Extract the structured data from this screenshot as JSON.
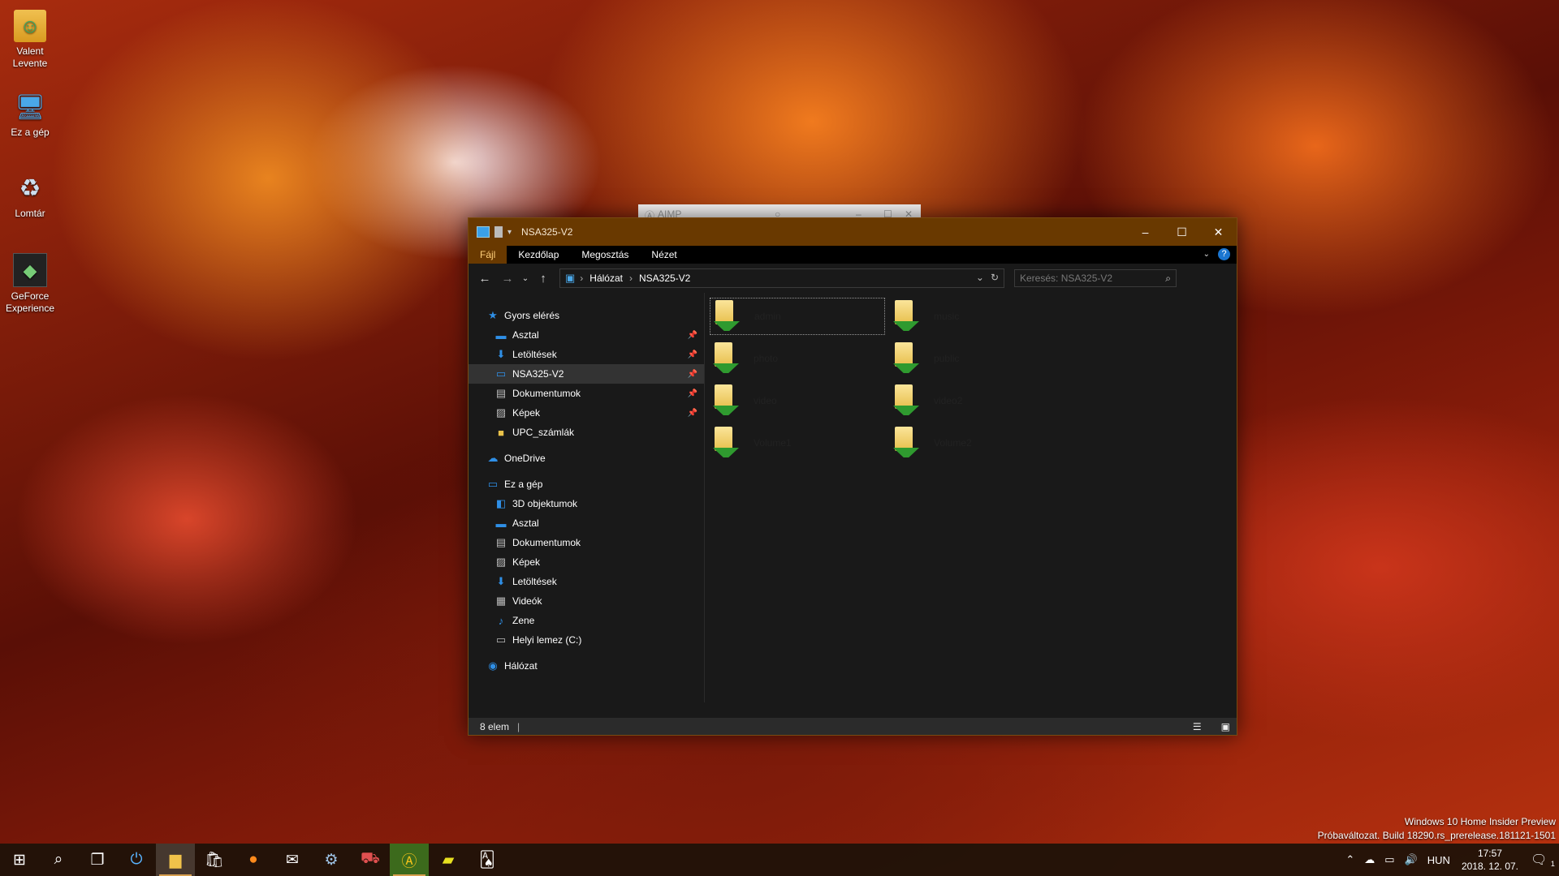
{
  "desktop": {
    "icons": [
      {
        "label_line1": "Valent",
        "label_line2": "Levente",
        "icon": "user-folder-icon"
      },
      {
        "label_line1": "Ez a gép",
        "label_line2": "",
        "icon": "computer-icon"
      },
      {
        "label_line1": "Lomtár",
        "label_line2": "",
        "icon": "recycle-bin-icon"
      },
      {
        "label_line1": "GeForce",
        "label_line2": "Experience",
        "icon": "geforce-experience-icon"
      }
    ]
  },
  "aimp": {
    "title": "AIMP"
  },
  "explorer": {
    "title": "NSA325-V2",
    "ribbon_tabs": [
      "Fájl",
      "Kezdőlap",
      "Megosztás",
      "Nézet"
    ],
    "breadcrumb": [
      "Hálózat",
      "NSA325-V2"
    ],
    "search_placeholder": "Keresés: NSA325-V2",
    "nav": {
      "quick_access": "Gyors elérés",
      "quick_items": [
        "Asztal",
        "Letöltések",
        "NSA325-V2",
        "Dokumentumok",
        "Képek",
        "UPC_számlák"
      ],
      "onedrive": "OneDrive",
      "this_pc": "Ez a gép",
      "pc_items": [
        "3D objektumok",
        "Asztal",
        "Dokumentumok",
        "Képek",
        "Letöltések",
        "Videók",
        "Zene",
        "Helyi lemez (C:)"
      ],
      "network": "Hálózat"
    },
    "folders": [
      "admin",
      "music",
      "photo",
      "public",
      "video",
      "video2",
      "Volume1",
      "Volume2"
    ],
    "status": "8 elem"
  },
  "watermark": {
    "line1": "Windows 10 Home Insider Preview",
    "line2": "Próbaváltozat. Build 18290.rs_prerelease.181121-1501"
  },
  "taskbar": {
    "language": "HUN",
    "time": "17:57",
    "date": "2018. 12. 07.",
    "notification_count": "1"
  }
}
